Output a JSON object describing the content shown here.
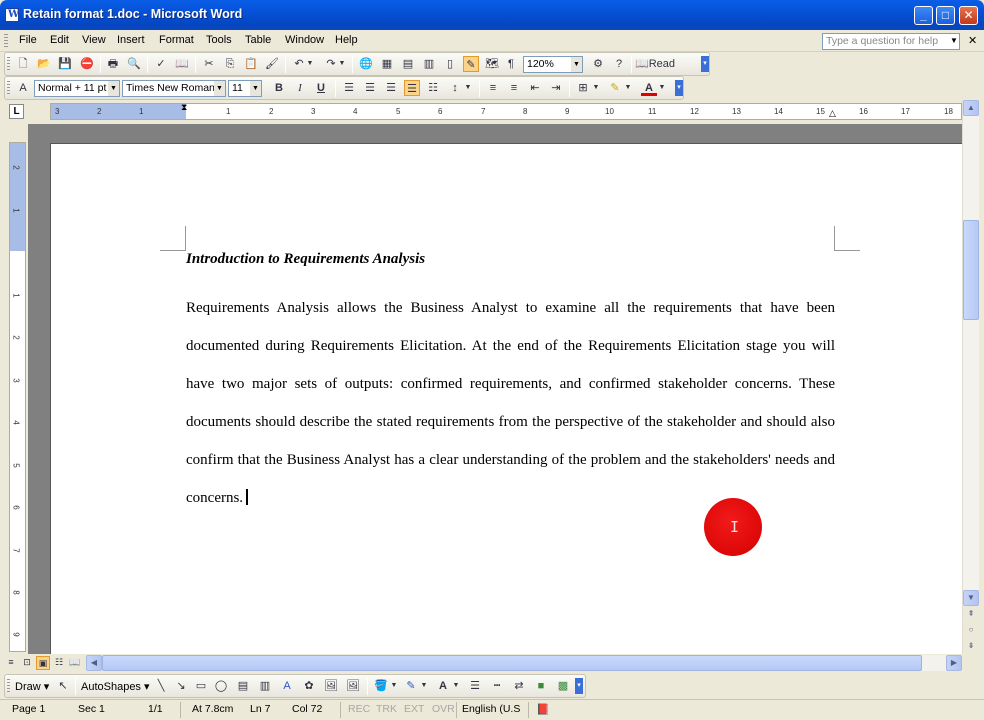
{
  "window": {
    "title": "Retain format 1.doc - Microsoft Word"
  },
  "menu": [
    "File",
    "Edit",
    "View",
    "Insert",
    "Format",
    "Tools",
    "Table",
    "Window",
    "Help"
  ],
  "ask_placeholder": "Type a question for help",
  "standard_toolbar": {
    "zoom": "120%",
    "read_label": "Read"
  },
  "format_toolbar": {
    "style": "Normal + 11 pt",
    "font": "Times New Roman",
    "size": "11"
  },
  "ruler": {
    "h_left_labels": [
      "3",
      "2",
      "1"
    ],
    "h_right_labels": [
      "1",
      "2",
      "3",
      "4",
      "5",
      "6",
      "7",
      "8",
      "9",
      "10",
      "11",
      "12",
      "13",
      "14",
      "15",
      "16",
      "17",
      "18"
    ],
    "v_labels": [
      "2",
      "1",
      "1",
      "2",
      "3",
      "4",
      "5",
      "6",
      "7",
      "8",
      "9"
    ]
  },
  "document": {
    "heading": "Introduction to Requirements Analysis",
    "body": "Requirements Analysis allows the Business Analyst to examine all the requirements that have been documented during Requirements Elicitation. At the end of the Requirements Elicitation stage you will have two major sets of outputs: confirmed requirements, and confirmed stakeholder concerns. These documents should describe the stated requirements from the perspective of the stakeholder and should also confirm that the Business Analyst has a clear understanding of the problem and the stakeholders' needs and concerns."
  },
  "draw_toolbar": {
    "draw_label": "Draw",
    "autoshapes_label": "AutoShapes"
  },
  "status": {
    "page": "Page 1",
    "sec": "Sec 1",
    "pages": "1/1",
    "at": "At 7.8cm",
    "ln": "Ln 7",
    "col": "Col 72",
    "rec": "REC",
    "trk": "TRK",
    "ext": "EXT",
    "ovr": "OVR",
    "lang": "English (U.S"
  },
  "colors": {
    "title_bar": "#0550d4",
    "pointer": "#e00000",
    "ruler_margin": "#a7bde6"
  }
}
